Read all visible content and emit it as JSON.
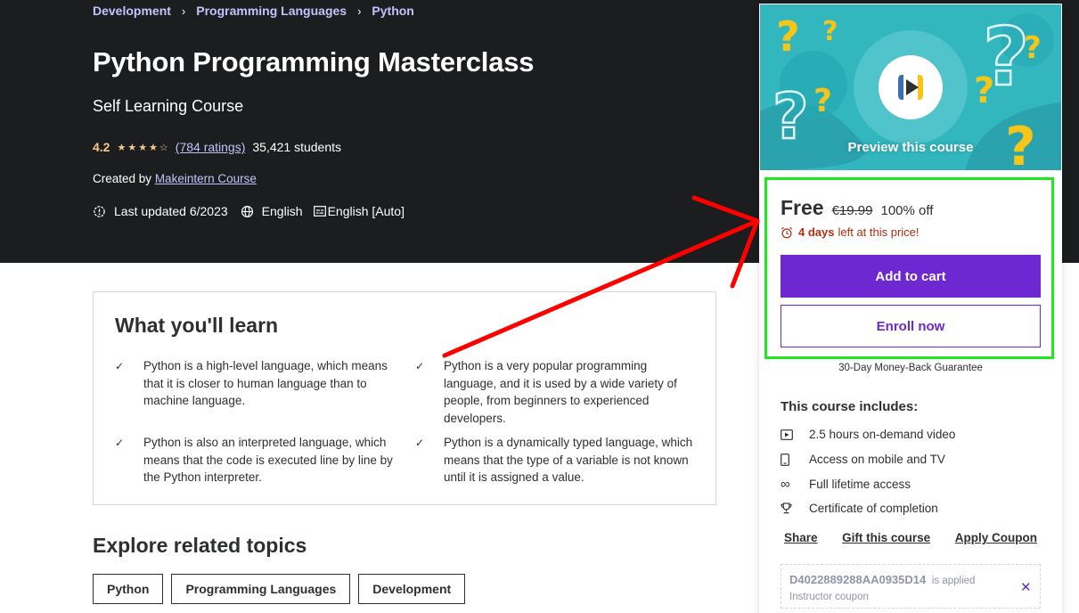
{
  "breadcrumb": [
    "Development",
    "Programming Languages",
    "Python"
  ],
  "course": {
    "title": "Python Programming Masterclass",
    "subtitle": "Self Learning Course",
    "rating": "4.2",
    "ratings_count": "(784 ratings)",
    "students": "35,421 students",
    "created_by_label": "Created by",
    "author": "Makeintern Course",
    "last_updated": "Last updated 6/2023",
    "language": "English",
    "captions": "English [Auto]"
  },
  "learn": {
    "title": "What you'll learn",
    "items": [
      "Python is a high-level language, which means that it is closer to human language than to machine language.",
      "Python is a very popular programming language, and it is used by a wide variety of people, from beginners to experienced developers.",
      "Python is also an interpreted language, which means that the code is executed line by line by the Python interpreter.",
      "Python is a dynamically typed language, which means that the type of a variable is not known until it is assigned a value."
    ]
  },
  "related": {
    "title": "Explore related topics",
    "topics": [
      "Python",
      "Programming Languages",
      "Development"
    ]
  },
  "sidebar": {
    "preview_label": "Preview this course",
    "price_current": "Free",
    "price_original": "€19.99",
    "discount": "100% off",
    "timer_bold": "4 days",
    "timer_rest": "left at this price!",
    "add_to_cart": "Add to cart",
    "enroll_now": "Enroll now",
    "guarantee": "30-Day Money-Back Guarantee",
    "includes_title": "This course includes:",
    "includes": [
      {
        "icon": "video-icon",
        "label": "2.5 hours on-demand video"
      },
      {
        "icon": "mobile-icon",
        "label": "Access on mobile and TV"
      },
      {
        "icon": "infinity-icon",
        "label": "Full lifetime access"
      },
      {
        "icon": "trophy-icon",
        "label": "Certificate of completion"
      }
    ],
    "actions": [
      "Share",
      "Gift this course",
      "Apply Coupon"
    ],
    "coupon": {
      "code": "D4022889288AA0935D14",
      "applied": "is applied",
      "type": "Instructor coupon"
    }
  },
  "colors": {
    "hero_bg": "#1c1d1f",
    "link_purple": "#c0c4fc",
    "rating_gold": "#f3ca8c",
    "brand_purple": "#6d28d2",
    "timer_red": "#b32d0f",
    "annotation_green": "#1ee81e",
    "annotation_red": "#ff0000"
  }
}
